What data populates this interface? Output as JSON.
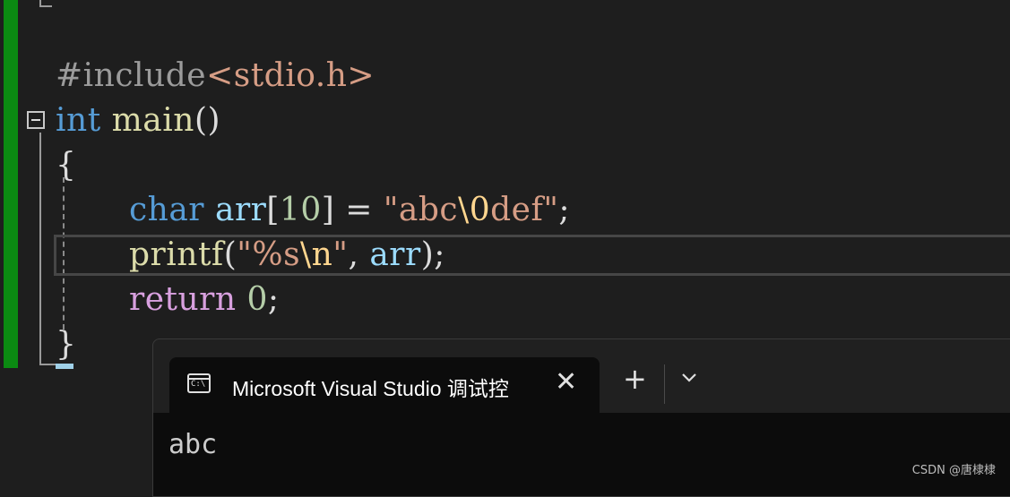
{
  "code": {
    "line1": {
      "directive": "#include",
      "header": "<stdio.h>"
    },
    "line2": {
      "type": "int",
      "func": "main",
      "parens": "()"
    },
    "line3": {
      "brace": "{"
    },
    "line4": {
      "type": "char",
      "var": "arr",
      "lbr": "[",
      "size": "10",
      "rbr": "]",
      "eq": " = ",
      "q1": "\"",
      "str1": "abc",
      "esc": "\\0",
      "str2": "def",
      "q2": "\"",
      "semi": ";"
    },
    "line5": {
      "func": "printf",
      "lp": "(",
      "q1": "\"",
      "fmt": "%s",
      "esc": "\\n",
      "q2": "\"",
      "comma": ", ",
      "arg": "arr",
      "rp": ")",
      "semi": ";"
    },
    "line6": {
      "kw": "return",
      "val": "0",
      "semi": ";"
    },
    "line7": {
      "brace": "}"
    }
  },
  "terminal": {
    "icon_text": "C:\\",
    "tab_title": "Microsoft Visual Studio 调试控",
    "close": "✕",
    "new_tab": "+",
    "output": "abc"
  },
  "watermark": "CSDN @唐棣棣"
}
